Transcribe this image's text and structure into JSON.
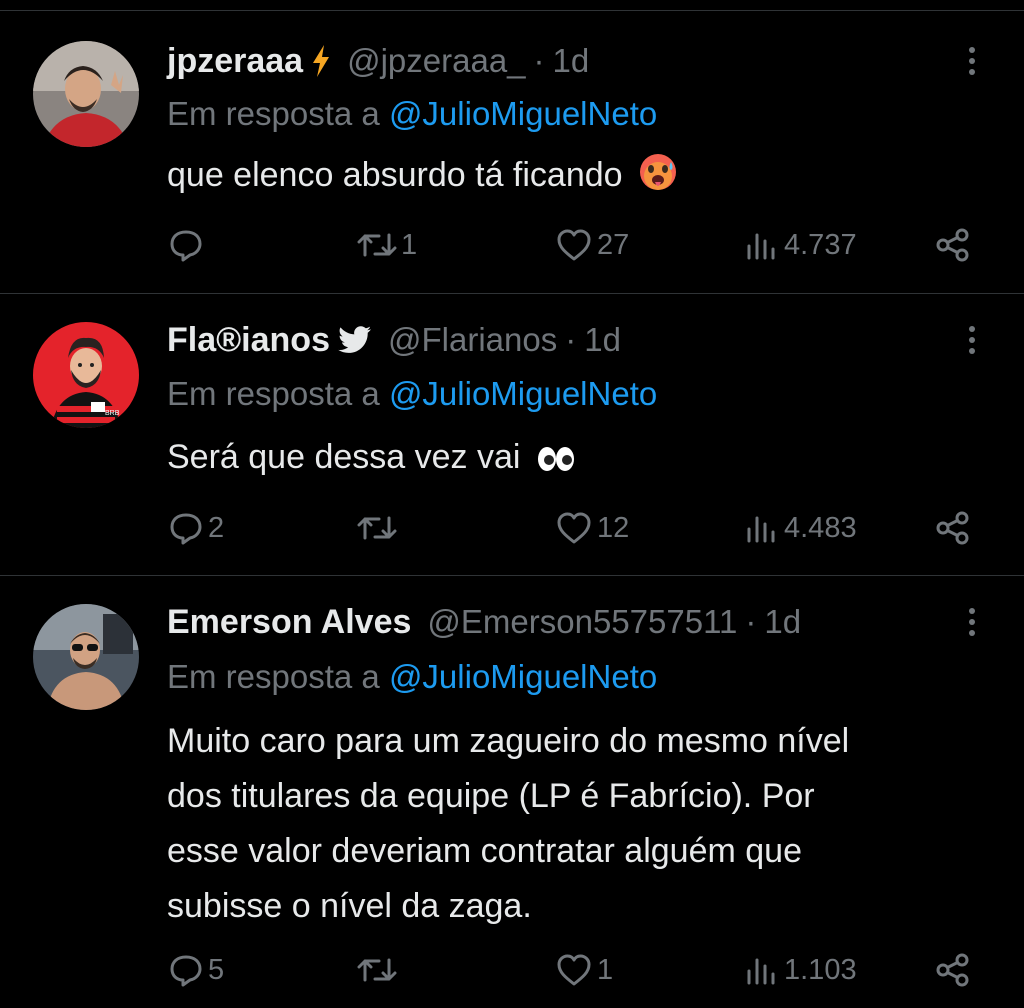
{
  "tweets": [
    {
      "name": "jpzeraaa",
      "handle": "@jpzeraaa_",
      "time": "1d",
      "dot": "·",
      "reply_prefix": "Em resposta a",
      "reply_to": "@JulioMiguelNeto",
      "text": "que elenco absurdo tá ficando",
      "emoji": "hot-face-emoji",
      "badge": "lightning-icon",
      "replies": "",
      "retweets": "1",
      "likes": "27",
      "views": "4.737"
    },
    {
      "name": "Fla®ianos",
      "handle": "@Flarianos",
      "time": "1d",
      "dot": "·",
      "reply_prefix": "Em resposta a",
      "reply_to": "@JulioMiguelNeto",
      "text": "Será que dessa vez vai",
      "emoji": "eyes-emoji",
      "badge": "bird-icon",
      "avatar_caption": "BRB",
      "replies": "2",
      "retweets": "",
      "likes": "12",
      "views": "4.483"
    },
    {
      "name": "Emerson Alves",
      "handle": "@Emerson55757511",
      "time": "1d",
      "dot": "·",
      "reply_prefix": "Em resposta a",
      "reply_to": "@JulioMiguelNeto",
      "text_lines": [
        "Muito caro para um zagueiro do mesmo nível",
        "dos titulares da equipe (LP é Fabrício). Por",
        "esse valor deveriam contratar alguém que",
        "subisse o nível da zaga."
      ],
      "replies": "5",
      "retweets": "",
      "likes": "1",
      "views": "1.103"
    }
  ],
  "colors": {
    "background": "#000000",
    "text": "#e7e9ea",
    "muted": "#71767b",
    "link": "#1d9bf0",
    "badge_lightning": "#f5a623",
    "separator": "#2f3336"
  }
}
